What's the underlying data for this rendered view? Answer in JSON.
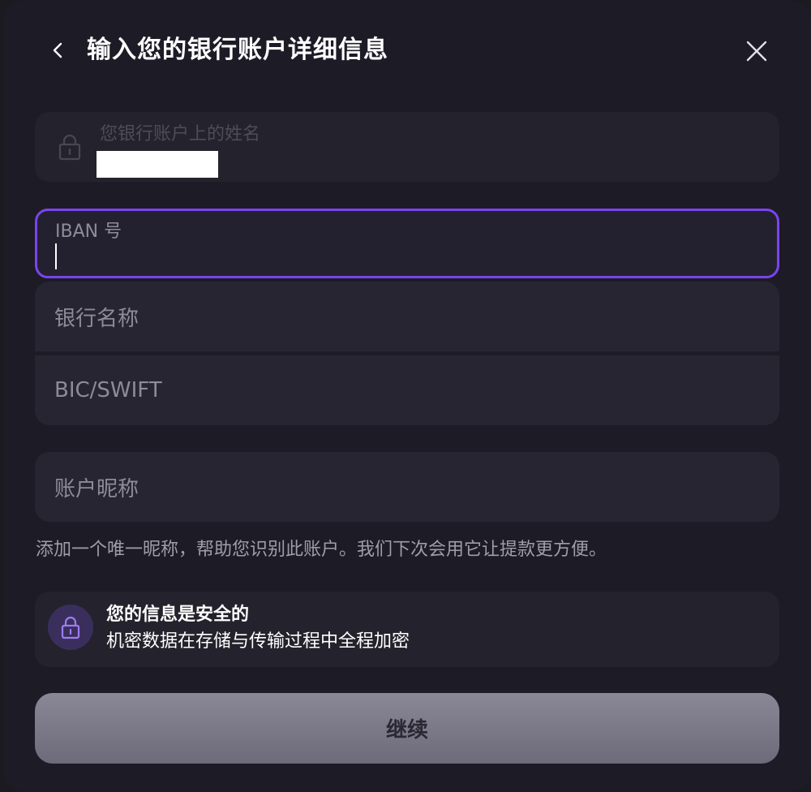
{
  "header": {
    "title": "输入您的银行账户详细信息",
    "back_icon": "chevron-left-icon",
    "close_icon": "close-icon"
  },
  "form": {
    "account_name": {
      "label": "您银行账户上的姓名",
      "locked": true,
      "value_redacted": true
    },
    "iban": {
      "label": "IBAN 号",
      "value": ""
    },
    "bank_name": {
      "placeholder": "银行名称"
    },
    "bic_swift": {
      "placeholder": "BIC/SWIFT"
    },
    "nickname": {
      "placeholder": "账户昵称",
      "hint": "添加一个唯一昵称，帮助您识别此账户。我们下次会用它让提款更方便。"
    }
  },
  "security": {
    "title": "您的信息是安全的",
    "description": "机密数据在存储与传输过程中全程加密",
    "icon": "lock-icon"
  },
  "actions": {
    "continue_label": "继续"
  },
  "colors": {
    "accent": "#7a44ee",
    "background": "#1d1b26",
    "field": "#272531",
    "button": "#7f7c8b"
  }
}
